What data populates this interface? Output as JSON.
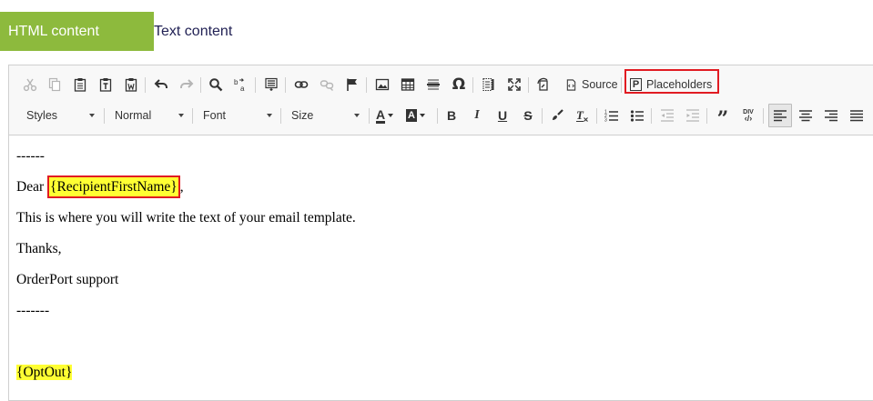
{
  "tabs": {
    "html_label": "HTML content",
    "text_label": "Text content"
  },
  "toolbar": {
    "row1": {
      "cut_icon": "scissors-icon",
      "copy_icon": "copy-icon",
      "paste_icon": "clipboard-icon",
      "source_label": "Source",
      "placeholders_label": "Placeholders",
      "placeholders_icon_text": "P"
    },
    "row2": {
      "styles": "Styles",
      "format": "Normal",
      "font": "Font",
      "size": "Size",
      "bold": "B",
      "italic": "I",
      "underline": "U",
      "strike": "S",
      "text_color_letter": "A",
      "bg_color_letter": "A",
      "blockquote": "”",
      "div_label": "DIV"
    }
  },
  "content": {
    "sep_top": "------",
    "greeting_prefix": "Dear ",
    "placeholder_name": "{RecipientFirstName}",
    "greeting_suffix": ",",
    "body_line": "This is where you will write the text of your email template.",
    "thanks": "Thanks,",
    "signature": "OrderPort support",
    "sep_bottom": "-------",
    "optout": "{OptOut}"
  },
  "colors": {
    "tab_active_bg": "#8dba3d",
    "highlight": "#ffff33",
    "callout_red": "#e11b22"
  }
}
